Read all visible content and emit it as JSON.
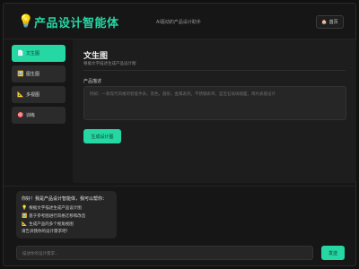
{
  "header": {
    "logo_icon": "💡",
    "title": "产品设计智能体",
    "subtitle": "AI驱动的产品设计助手",
    "home_icon": "🏠",
    "home_label": "首页"
  },
  "sidebar": {
    "items": [
      {
        "icon": "📄",
        "label": "文生图",
        "active": true
      },
      {
        "icon": "🖼️",
        "label": "图生图",
        "active": false
      },
      {
        "icon": "📐",
        "label": "多视图",
        "active": false
      },
      {
        "icon": "🎯",
        "label": "训练",
        "active": false
      }
    ]
  },
  "main": {
    "title": "文生图",
    "description": "根据文字描述生成产品设计图",
    "field_label": "产品描述",
    "placeholder": "例如：一款现代风格的智能手表，黑色，圆形，金属表壳，不锈钢表带，蓝宝石玻璃镜面，简约表盘设计",
    "generate_label": "生成设计图"
  },
  "chat": {
    "greeting": "你好！我是产品设计智能体，我可以帮你：",
    "capabilities": [
      {
        "icon": "💡",
        "text": "根据文字描述生成产品设计图"
      },
      {
        "icon": "🖼️",
        "text": "基于参考图进行风格迁移和改造"
      },
      {
        "icon": "📐",
        "text": "生成产品的多个视角视图"
      }
    ],
    "prompt": "请告诉我你的设计需求吧！",
    "input_placeholder": "描述你的设计需求...",
    "send_label": "发送"
  },
  "colors": {
    "accent": "#25d7a2",
    "background": "#111111",
    "panel": "#1d1d1d"
  }
}
